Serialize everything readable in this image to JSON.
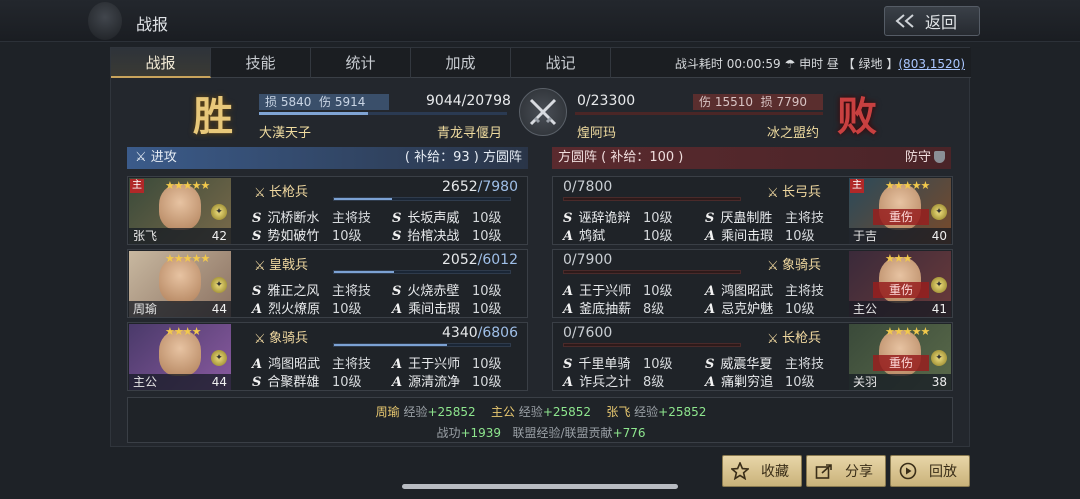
{
  "header": {
    "title": "战报",
    "back_label": "返回"
  },
  "tabs": [
    {
      "label": "战报",
      "active": true
    },
    {
      "label": "技能",
      "active": false
    },
    {
      "label": "统计",
      "active": false
    },
    {
      "label": "加成",
      "active": false
    },
    {
      "label": "战记",
      "active": false
    }
  ],
  "battle_info": {
    "duration_label": "战斗耗时",
    "duration": "00:00:59",
    "weather": "申时 昼",
    "terrain": "【 绿地 】",
    "coords": "(803,1520)"
  },
  "result": {
    "win_glyph": "胜",
    "lose_glyph": "败",
    "left": {
      "loss_label": "损",
      "loss": "5840",
      "injury_label": "伤",
      "injury": "5914",
      "troops_current": "9044",
      "troops_max": "/20798",
      "troop_fraction": 0.435,
      "player": "大漢天子",
      "alliance": "青龙寻偃月"
    },
    "right": {
      "troops": "0/23300",
      "troop_fraction": 0.0,
      "injury_label": "伤",
      "injury": "15510",
      "loss_label": "损",
      "loss": "7790",
      "player": "煌阿玛",
      "alliance": "冰之盟约"
    }
  },
  "attack_side": {
    "label": "进攻",
    "supply": "( 补给：93 ) 方圆阵"
  },
  "defense_side": {
    "label": "方圆阵 ( 补给：100 )",
    "role": "防守"
  },
  "attackers": [
    {
      "name": "张飞",
      "level": "42",
      "stars": "★★★★★",
      "is_main": true,
      "main_label": "主",
      "unit": "长枪兵",
      "hp_current": "2652",
      "hp_max": "/7980",
      "hp_fraction": 0.33,
      "skills": [
        {
          "type": "S",
          "name": "沉桥断水",
          "level": "主将技"
        },
        {
          "type": "S",
          "name": "长坂声威",
          "level": "10级"
        },
        {
          "type": "S",
          "name": "势如破竹",
          "level": "10级"
        },
        {
          "type": "S",
          "name": "抬棺决战",
          "level": "10级"
        }
      ],
      "colors": {
        "bg1": "#3a4a3a",
        "bg2": "#7a6a4a"
      }
    },
    {
      "name": "周瑜",
      "level": "44",
      "stars": "★★★★★",
      "is_main": false,
      "unit": "皇戟兵",
      "hp_current": "2052",
      "hp_max": "/6012",
      "hp_fraction": 0.34,
      "skills": [
        {
          "type": "S",
          "name": "雅正之风",
          "level": "主将技"
        },
        {
          "type": "S",
          "name": "火烧赤壁",
          "level": "10级"
        },
        {
          "type": "A",
          "name": "烈火燎原",
          "level": "10级"
        },
        {
          "type": "A",
          "name": "乘间击瑕",
          "level": "10级"
        }
      ],
      "colors": {
        "bg1": "#c8b8a0",
        "bg2": "#8a7060"
      }
    },
    {
      "name": "主公",
      "level": "44",
      "stars": "★★★★",
      "is_main": false,
      "unit": "象骑兵",
      "hp_current": "4340",
      "hp_max": "/6806",
      "hp_fraction": 0.64,
      "skills": [
        {
          "type": "A",
          "name": "鸿图昭武",
          "level": "主将技"
        },
        {
          "type": "A",
          "name": "王于兴师",
          "level": "10级"
        },
        {
          "type": "S",
          "name": "合聚群雄",
          "level": "10级"
        },
        {
          "type": "A",
          "name": "源清流净",
          "level": "10级"
        }
      ],
      "colors": {
        "bg1": "#4a3a6a",
        "bg2": "#8a5aa0"
      }
    }
  ],
  "defenders": [
    {
      "name": "于吉",
      "level": "40",
      "stars": "★★★★★",
      "is_main": true,
      "main_label": "主",
      "injured_label": "重伤",
      "unit": "长弓兵",
      "hp": "0/7800",
      "hp_fraction": 0.0,
      "skills": [
        {
          "type": "S",
          "name": "诬辞诡辩",
          "level": "10级"
        },
        {
          "type": "S",
          "name": "厌蛊制胜",
          "level": "主将技"
        },
        {
          "type": "A",
          "name": "鸩弑",
          "level": "10级"
        },
        {
          "type": "A",
          "name": "乘间击瑕",
          "level": "10级"
        }
      ],
      "colors": {
        "bg1": "#2a4a5a",
        "bg2": "#7a4a2a"
      }
    },
    {
      "name": "主公",
      "level": "41",
      "stars": "★★★",
      "is_main": false,
      "injured_label": "重伤",
      "unit": "象骑兵",
      "hp": "0/7900",
      "hp_fraction": 0.0,
      "skills": [
        {
          "type": "A",
          "name": "王于兴师",
          "level": "10级"
        },
        {
          "type": "A",
          "name": "鸿图昭武",
          "level": "主将技"
        },
        {
          "type": "A",
          "name": "釜底抽薪",
          "level": "8级"
        },
        {
          "type": "A",
          "name": "忌克妒魅",
          "level": "10级"
        }
      ],
      "colors": {
        "bg1": "#3a2a3a",
        "bg2": "#6a3a3a"
      }
    },
    {
      "name": "关羽",
      "level": "38",
      "stars": "★★★★★",
      "is_main": false,
      "injured_label": "重伤",
      "unit": "长枪兵",
      "hp": "0/7600",
      "hp_fraction": 0.0,
      "skills": [
        {
          "type": "S",
          "name": "千里单骑",
          "level": "10级"
        },
        {
          "type": "S",
          "name": "威震华夏",
          "level": "主将技"
        },
        {
          "type": "A",
          "name": "诈兵之计",
          "level": "8级"
        },
        {
          "type": "A",
          "name": "痛剿穷追",
          "level": "10级"
        }
      ],
      "colors": {
        "bg1": "#3a4a3a",
        "bg2": "#5a6a4a"
      }
    }
  ],
  "rewards": {
    "exp": [
      {
        "name": "周瑜",
        "label": "经验",
        "value": "+25852"
      },
      {
        "name": "主公",
        "label": "经验",
        "value": "+25852"
      },
      {
        "name": "张飞",
        "label": "经验",
        "value": "+25852"
      }
    ],
    "merit_label": "战功",
    "merit": "+1939",
    "alliance_label": "联盟经验/联盟贡献",
    "alliance": "+776"
  },
  "buttons": {
    "favorite": "收藏",
    "share": "分享",
    "replay": "回放"
  }
}
